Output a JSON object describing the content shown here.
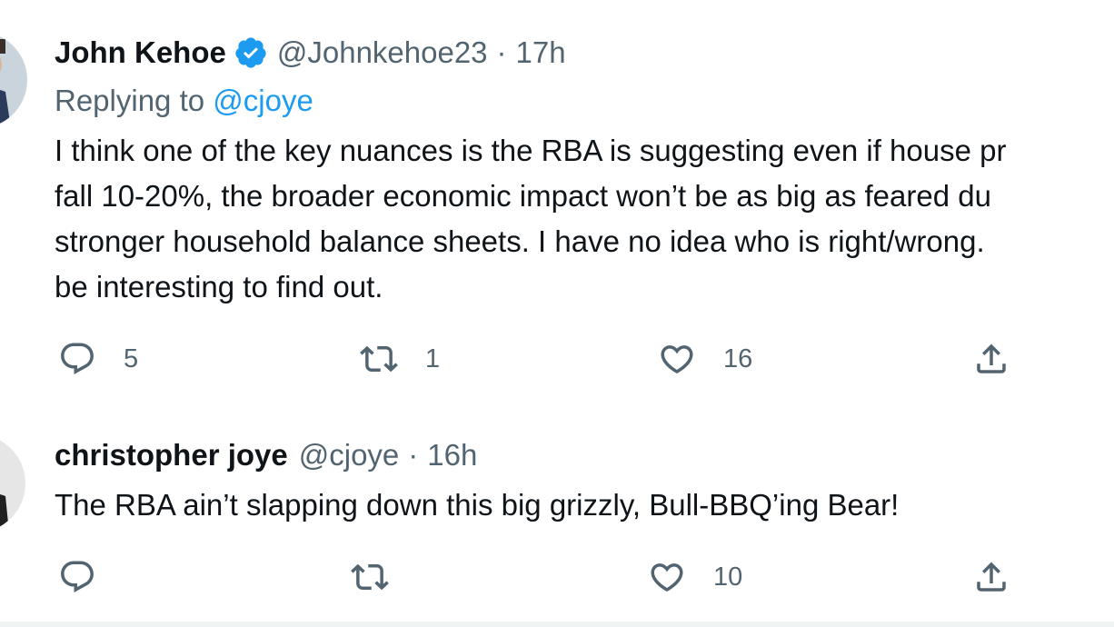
{
  "tweets": [
    {
      "author": "John Kehoe",
      "verified": true,
      "handle": "@Johnkehoe23",
      "separator": "·",
      "time": "17h",
      "replying_prefix": "Replying to",
      "replying_to": "@cjoye",
      "lines": [
        "I think one of the key nuances is the RBA is suggesting even if house pr",
        "fall 10-20%, the broader economic impact won’t be as big as feared du",
        "stronger household balance sheets. I have no idea who is right/wrong.",
        "be interesting to find out."
      ],
      "reply_count": "5",
      "retweet_count": "1",
      "like_count": "16"
    },
    {
      "author": "christopher joye",
      "verified": false,
      "handle": "@cjoye",
      "separator": "·",
      "time": "16h",
      "lines": [
        "The RBA ain’t slapping down this big grizzly, Bull-BBQ’ing Bear!"
      ],
      "reply_count": "",
      "retweet_count": "",
      "like_count": "10"
    }
  ],
  "icons": {
    "reply": "reply-icon",
    "retweet": "retweet-icon",
    "like": "heart-icon",
    "share": "share-icon",
    "verified": "verified-badge-icon"
  },
  "colors": {
    "text": "#0f1419",
    "secondary": "#536471",
    "accent": "#1d9bf0"
  }
}
